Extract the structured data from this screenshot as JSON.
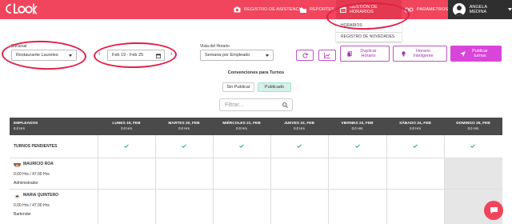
{
  "nav": {
    "items": [
      {
        "label": "REGISTRO DE ASISTENCIA",
        "icon": "camera-icon"
      },
      {
        "label": "REPORTES",
        "icon": "folder-icon"
      },
      {
        "label": "GESTIÓN DE HORARIOS",
        "icon": "calendar-icon"
      },
      {
        "label": "PARÁMETROS",
        "icon": "gears-icon"
      }
    ],
    "user_name": "ANGELA MEDINA",
    "dropdown": {
      "items": [
        "HORARIOS",
        "REGISTRO DE NOVEDADES"
      ]
    }
  },
  "toolbar": {
    "sucursal_label": "Sucursal",
    "sucursal_value": "Restaurante Laureles",
    "date_range": "Feb 19 - Feb 25",
    "vista_label": "Vista del Horario",
    "vista_value": "Semana por Empleado",
    "duplicate_label": "Duplicar Horario",
    "smart_label": "Horario Inteligente",
    "publish_label": "Publicar turnos"
  },
  "conventions": {
    "title": "Convenciones para Turnos",
    "unpublished": "Sin Publicar",
    "published": "Publicado"
  },
  "filter": {
    "placeholder": "Filtrar..."
  },
  "table": {
    "employees_header": "EMPLEADOS",
    "employees_sub": "0.0 Hrs",
    "days": [
      {
        "label": "LUNES 19, FEB",
        "hours": "0.0 Hrs"
      },
      {
        "label": "MARTES 20, FEB",
        "hours": "0.0 Hrs"
      },
      {
        "label": "MIÉRCOLES 21, FEB",
        "hours": "0.0 Hrs"
      },
      {
        "label": "JUEVES 22, FEB",
        "hours": "0.0 Hrs"
      },
      {
        "label": "VIERNES 23, FEB",
        "hours": "0.0 Hrs"
      },
      {
        "label": "SÁBADO 24, FEB",
        "hours": "0.0 Hrs"
      },
      {
        "label": "DOMINGO 25, FEB",
        "hours": "0.0 Hrs"
      }
    ],
    "pending_label": "TURNOS PENDIENTES",
    "employees": [
      {
        "name": "MAURICIO ROA",
        "hours": "0.00 Hrs / 47.00 Hrs",
        "role": "Administrador"
      },
      {
        "name": "MARIA QUINTERO",
        "hours": "0.00 Hrs / 47.00 Hrs",
        "role": "Bartender"
      }
    ]
  },
  "colors": {
    "brand": "#f0455c",
    "accent": "#d945d9",
    "header": "#4a4a4a",
    "check": "#1aa37a"
  }
}
